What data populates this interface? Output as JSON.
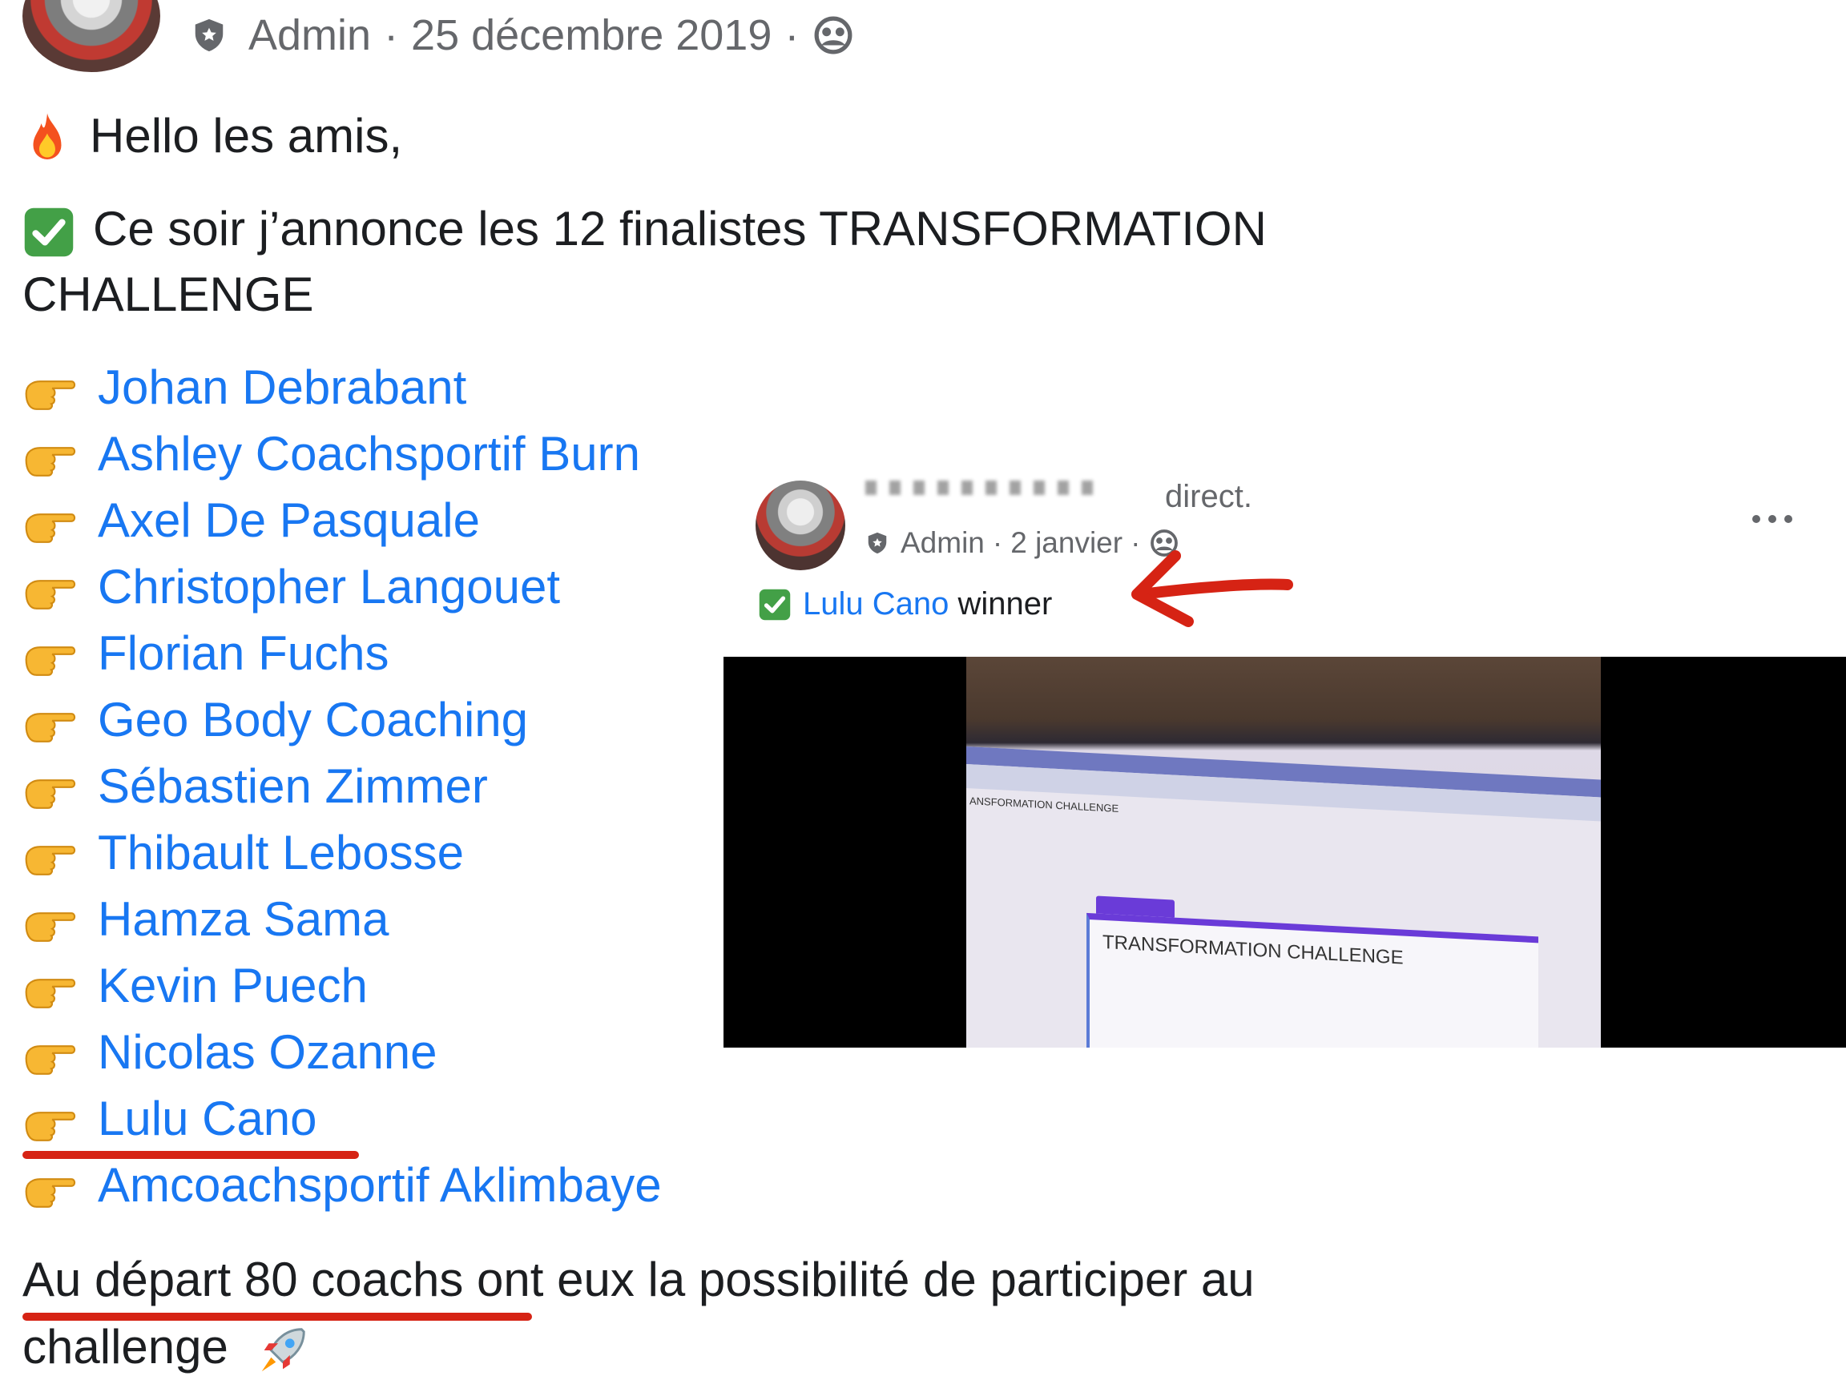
{
  "main_post": {
    "author_role": "Admin",
    "separator": "·",
    "date": "25 décembre 2019",
    "greeting": "Hello les amis,",
    "announcement_line1": "Ce soir j’annonce les 12 finalistes TRANSFORMATION",
    "announcement_line2": "CHALLENGE",
    "finalists": [
      "Johan Debrabant",
      "Ashley Coachsportif Burn",
      "Axel De Pasquale",
      "Christopher Langouet",
      "Florian Fuchs",
      "Geo Body Coaching",
      "Sébastien Zimmer",
      "Thibault Lebosse",
      "Hamza Sama",
      "Kevin Puech",
      "Nicolas Ozanne",
      "Lulu Cano",
      "Amcoachsportif Aklimbaye"
    ],
    "footer_line1": "Au départ 80 coachs ont eux la possibilité de participer au",
    "footer_line2": "challenge"
  },
  "inset_post": {
    "direct_text": "direct.",
    "author_role": "Admin",
    "separator": "·",
    "date": "2 janvier",
    "winner_name": "Lulu Cano",
    "winner_label": "winner",
    "video": {
      "form_title": "TRANSFORMATION CHALLENGE",
      "doc_title": "ANSFORMATION CHALLENGE"
    }
  },
  "colors": {
    "link_blue": "#1877f2",
    "annotation_red": "#d62314",
    "meta_gray": "#65676b"
  },
  "icons": [
    "shield-icon",
    "globe-icon",
    "fire-icon",
    "check-icon",
    "hand-icon",
    "rocket-icon",
    "more-icon",
    "arrow-icon"
  ]
}
